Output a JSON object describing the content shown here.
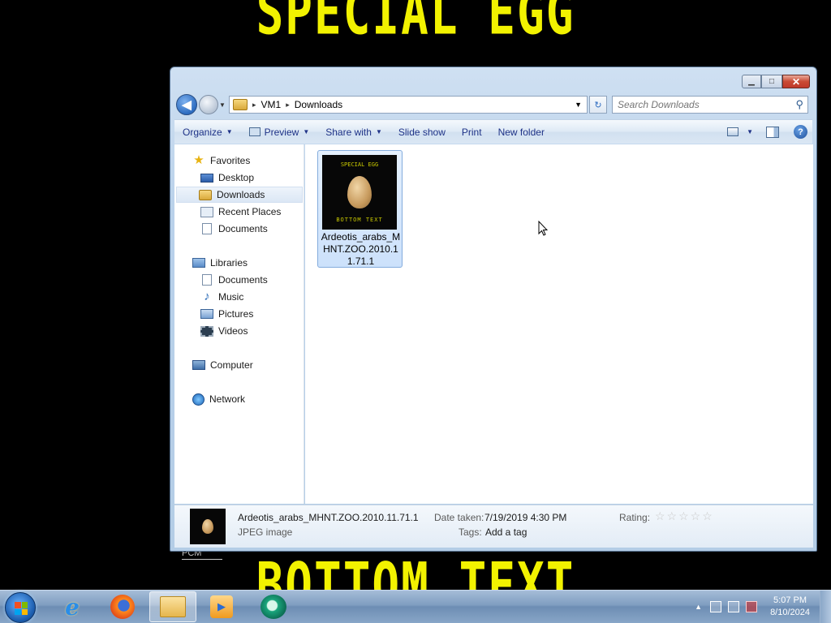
{
  "wallpaper": {
    "top_text": "SPECIAL EGG",
    "bottom_text": "BOTTOM TEXT",
    "fragment_text": "PCM"
  },
  "window": {
    "caption": {
      "minimize": "▁",
      "maximize": "□",
      "close": "✕"
    },
    "nav": {
      "back": "◀",
      "forward": "",
      "dropdown": "▼"
    },
    "address": {
      "root": "VM1",
      "folder": "Downloads",
      "separator": "▸",
      "dropdown": "▼"
    },
    "refresh": "↻",
    "search": {
      "placeholder": "Search Downloads",
      "icon": "search-icon"
    },
    "toolbar": {
      "organize": "Organize",
      "preview": "Preview",
      "share_with": "Share with",
      "slide_show": "Slide show",
      "print": "Print",
      "new_folder": "New folder",
      "dropdown_arrow": "▼",
      "help": "?"
    },
    "sidebar": {
      "favorites": "Favorites",
      "desktop": "Desktop",
      "downloads": "Downloads",
      "recent_places": "Recent Places",
      "documents": "Documents",
      "libraries": "Libraries",
      "lib_documents": "Documents",
      "music": "Music",
      "pictures": "Pictures",
      "videos": "Videos",
      "computer": "Computer",
      "network": "Network",
      "star_glyph": "★",
      "note_glyph": "♪"
    },
    "files": [
      {
        "name": "Ardeotis_arabs_MHNT.ZOO.2010.11.71.1",
        "thumb_top": "SPECIAL EGG",
        "thumb_bottom": "BOTTOM TEXT",
        "selected": true
      }
    ],
    "details": {
      "name": "Ardeotis_arabs_MHNT.ZOO.2010.11.71.1",
      "type": "JPEG image",
      "date_label": "Date taken:",
      "date_value": "7/19/2019 4:30 PM",
      "tags_label": "Tags:",
      "tags_value": "Add a tag",
      "rating_label": "Rating:",
      "rating_stars": "☆☆☆☆☆",
      "rating_value": 0
    }
  },
  "taskbar": {
    "apps": [
      "internet-explorer",
      "firefox",
      "windows-explorer",
      "windows-media-player",
      "green-app"
    ],
    "ie_glyph": "e",
    "wmp_glyph": "▶",
    "tray_expand": "▲",
    "clock": {
      "time": "5:07 PM",
      "date": "8/10/2024"
    }
  },
  "colors": {
    "meme_text": "#f2f200",
    "selection": "#cce1fb",
    "window_frame": "#b9d1ea",
    "taskbar": "#7f9dc0"
  }
}
